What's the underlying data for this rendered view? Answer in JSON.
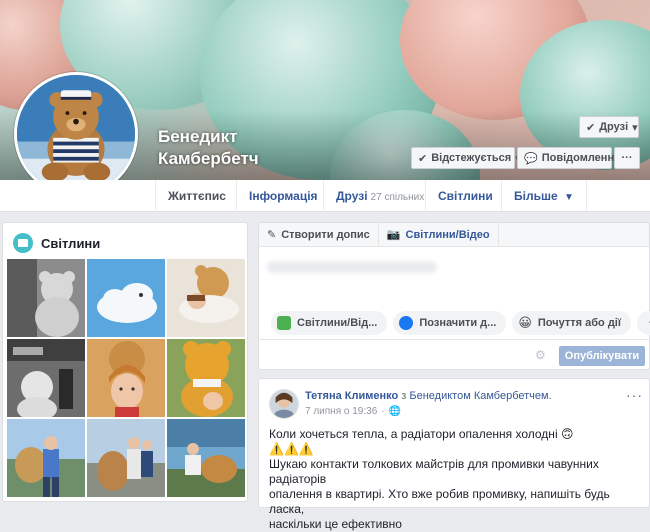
{
  "profile": {
    "name_line1": "Бенедикт",
    "name_line2": "Камбербетч"
  },
  "cover_actions": {
    "friends_label": "Друзі",
    "follow_label": "Відстежується",
    "message_label": "Повідомлення",
    "more_label": "···"
  },
  "tabs": [
    {
      "label": "Життєпис"
    },
    {
      "label": "Інформація"
    },
    {
      "label": "Друзі",
      "count": "27 спільних"
    },
    {
      "label": "Світлини"
    },
    {
      "label": "Більше"
    }
  ],
  "photos": {
    "title": "Світлини"
  },
  "composer": {
    "create_post": "Створити допис",
    "photo_video_tab": "Світлини/Відео",
    "actions": [
      "Світлини/Від...",
      "Позначити д...",
      "Почуття або дії"
    ],
    "more": "···",
    "publish": "Опублікувати"
  },
  "post": {
    "author": "Тетяна Клименко",
    "connector": "з",
    "with_person": "Бенедиктом Камбербетчем.",
    "date": "7 липня о 19:36",
    "dot": "·",
    "menu": "···",
    "line1": "Коли хочеться тепла, а радіатори опалення холодні 🙃",
    "line2": "⚠️⚠️⚠️",
    "line3": "Шукаю контакти толкових майстрів для промивки чавунних радіаторів",
    "line4": "опалення в квартирі. Хто вже робив промивку, напишіть будь ласка,",
    "line5": "наскільки це ефективно"
  },
  "colors": {
    "link": "#365899",
    "publish_disabled": "#9cb4d8",
    "photos_icon": "#44bec7"
  }
}
